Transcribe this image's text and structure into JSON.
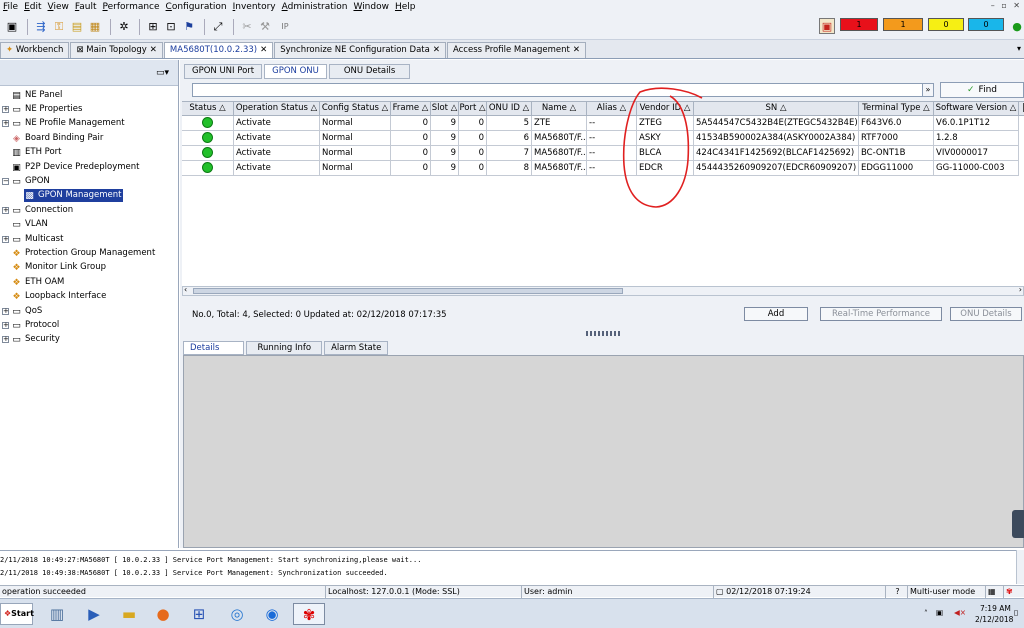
{
  "menu": {
    "items": [
      {
        "label": "File"
      },
      {
        "label": "Edit"
      },
      {
        "label": "View"
      },
      {
        "label": "Fault"
      },
      {
        "label": "Performance"
      },
      {
        "label": "Configuration"
      },
      {
        "label": "Inventory"
      },
      {
        "label": "Administration"
      },
      {
        "label": "Window"
      },
      {
        "label": "Help"
      }
    ]
  },
  "alarms": [
    {
      "label": "1",
      "color": "#e8101a"
    },
    {
      "label": "1",
      "color": "#f39a1c"
    },
    {
      "label": "0",
      "color": "#f6ef14"
    },
    {
      "label": "0",
      "color": "#19b6ea"
    }
  ],
  "tabs": [
    {
      "label": "Workbench"
    },
    {
      "label": "Main Topology"
    },
    {
      "label": "MA5680T(10.0.2.33)"
    },
    {
      "label": "Synchronize NE Configuration Data"
    },
    {
      "label": "Access Profile Management"
    }
  ],
  "sidebar": {
    "items": [
      {
        "label": "NE Panel"
      },
      {
        "label": "NE Properties"
      },
      {
        "label": "NE Profile Management"
      },
      {
        "label": "Board Binding Pair"
      },
      {
        "label": "ETH Port"
      },
      {
        "label": "P2P Device Predeployment"
      },
      {
        "label": "GPON"
      },
      {
        "label": "GPON Management"
      },
      {
        "label": "Connection"
      },
      {
        "label": "VLAN"
      },
      {
        "label": "Multicast"
      },
      {
        "label": "Protection Group Management"
      },
      {
        "label": "Monitor Link Group"
      },
      {
        "label": "ETH OAM"
      },
      {
        "label": "Loopback Interface"
      },
      {
        "label": "QoS"
      },
      {
        "label": "Protocol"
      },
      {
        "label": "Security"
      }
    ]
  },
  "subtabs": [
    {
      "label": "GPON UNI Port"
    },
    {
      "label": "GPON ONU"
    },
    {
      "label": "ONU Details"
    }
  ],
  "find_label": "Find",
  "table": {
    "columns": [
      "Status",
      "Operation Status",
      "Config Status",
      "Frame",
      "Slot",
      "Port",
      "ONU ID",
      "Name",
      "Alias",
      "Vendor ID",
      "SN",
      "Terminal Type",
      "Software Version"
    ],
    "rows": [
      [
        "",
        "Activate",
        "Normal",
        "0",
        "9",
        "0",
        "5",
        "ZTE",
        "--",
        "ZTEG",
        "5A544547C5432B4E(ZTEGC5432B4E)",
        "F643V6.0",
        "V6.0.1P1T12"
      ],
      [
        "",
        "Activate",
        "Normal",
        "0",
        "9",
        "0",
        "6",
        "MA5680T/F...",
        "--",
        "ASKY",
        "41534B590002A384(ASKY0002A384)",
        "RTF7000",
        "1.2.8"
      ],
      [
        "",
        "Activate",
        "Normal",
        "0",
        "9",
        "0",
        "7",
        "MA5680T/F...",
        "--",
        "BLCA",
        "424C4341F1425692(BLCAF1425692)",
        "BC-ONT1B",
        "VIV0000017"
      ],
      [
        "",
        "Activate",
        "Normal",
        "0",
        "9",
        "0",
        "8",
        "MA5680T/F...",
        "--",
        "EDCR",
        "4544435260909207(EDCR60909207)",
        "EDGG11000",
        "GG-11000-C003"
      ]
    ],
    "status_color": "#22c02a"
  },
  "summary": "No.0, Total: 4, Selected: 0   Updated at: 02/12/2018 07:17:35",
  "actions": {
    "add": "Add",
    "realtime": "Real-Time Performance",
    "onu_details": "ONU Details"
  },
  "detail_tabs": [
    {
      "label": "Details"
    },
    {
      "label": "Running Info"
    },
    {
      "label": "Alarm State"
    }
  ],
  "log": [
    "2/11/2018 10:49:27:MA5680T [ 10.0.2.33 ] Service Port Management: Start synchronizing,please wait...",
    "2/11/2018 10:49:38:MA5680T [ 10.0.2.33 ] Service Port Management: Synchronization succeeded."
  ],
  "statusbar": {
    "message": "operation succeeded",
    "host": "Localhost: 127.0.0.1 (Mode:  SSL)",
    "user": "User: admin",
    "datetime": "02/12/2018 07:19:24",
    "mode": "Multi-user mode"
  },
  "taskbar": {
    "start": "Start",
    "time": "7:19 AM",
    "date": "2/12/2018"
  },
  "annotation_color": "#e02020"
}
